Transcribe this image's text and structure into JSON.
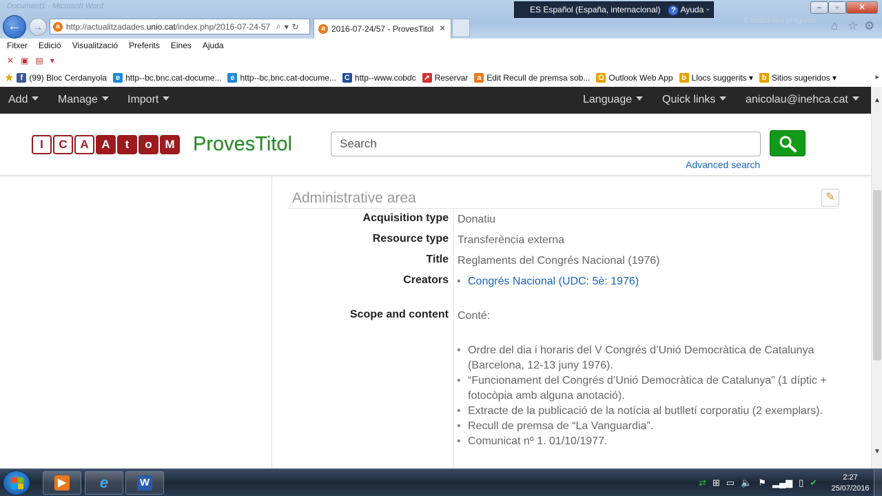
{
  "window": {
    "ghost_title": "Document1 - Microsoft Word",
    "language_bar": {
      "language": "ES Español (España, internacional)",
      "help": "Ayuda"
    },
    "search_ghost": "Escriba una pregunta"
  },
  "browser": {
    "url_prefix": "http://actualitzadades.",
    "url_host": "unio.cat",
    "url_path": "/index.php/2016-07-24-57",
    "tab_title": "2016-07-24/57 - ProvesTitol",
    "menu": [
      "Fitxer",
      "Edició",
      "Visualització",
      "Preferits",
      "Eines",
      "Ajuda"
    ],
    "favorites": [
      {
        "label": "(99) Bloc Cerdanyola",
        "icon": "facebook-icon",
        "color": "#3b5998",
        "glyph": "f"
      },
      {
        "label": "http--bc.bnc.cat-docume...",
        "icon": "ie-page-icon",
        "color": "#1e88d6",
        "glyph": "e"
      },
      {
        "label": "http--bc.bnc.cat-docume...",
        "icon": "ie-page-icon",
        "color": "#1e88d6",
        "glyph": "e"
      },
      {
        "label": "http--www.cobdc",
        "icon": "cobdc-icon",
        "color": "#1f4f9c",
        "glyph": "C"
      },
      {
        "label": "Reservar",
        "icon": "arrow-icon",
        "color": "#d32f2f",
        "glyph": "➚"
      },
      {
        "label": "Edit Recull de premsa sob...",
        "icon": "atom-site-icon",
        "color": "#e8791c",
        "glyph": "a"
      },
      {
        "label": "Outlook Web App",
        "icon": "outlook-icon",
        "color": "#e6a100",
        "glyph": "O"
      },
      {
        "label": "Llocs suggerits ▾",
        "icon": "bing-icon",
        "color": "#e6a100",
        "glyph": "b"
      },
      {
        "label": "Sitios sugeridos ▾",
        "icon": "bing-icon",
        "color": "#e6a100",
        "glyph": "b"
      }
    ]
  },
  "nav": {
    "add": "Add",
    "manage": "Manage",
    "import": "Import",
    "language": "Language",
    "quick_links": "Quick links",
    "user": "anicolau@inehca.cat"
  },
  "header": {
    "logo_letters": [
      "I",
      "C",
      "A",
      "A",
      "t",
      "o",
      "M"
    ],
    "site_name": "ProvesTitol",
    "search_placeholder": "Search",
    "advanced_search": "Advanced search"
  },
  "section": {
    "title": "Administrative area",
    "fields": {
      "acquisition_type": {
        "label": "Acquisition type",
        "value": "Donatiu"
      },
      "resource_type": {
        "label": "Resource type",
        "value": "Transferència externa"
      },
      "title": {
        "label": "Title",
        "value": "Reglaments del Congrés Nacional (1976)"
      },
      "creators": {
        "label": "Creators",
        "value": "Congrés Nacional (UDC: 5è: 1976)"
      },
      "scope": {
        "label": "Scope and content",
        "intro": "Conté:",
        "items": [
          "Ordre del dia i horaris del V Congrés d’Unió Democràtica de Catalunya (Barcelona, 12-13 juny 1976).",
          "“Funcionament del Congrés d’Unió Democràtica de Catalunya” (1 díptic + fotocòpia amb alguna anotació).",
          "Extracte de la publicació de la notícia al butlletí corporatiu (2 exemplars).",
          "Recull de premsa de “La Vanguardia”.",
          "Comunicat nº 1. 01/10/1977."
        ]
      }
    }
  },
  "taskbar": {
    "time": "2:27",
    "date": "25/07/2016"
  },
  "colors": {
    "brand_green": "#2e8a1d",
    "search_button": "#129b18",
    "logo_red": "#9b1b1f",
    "link_blue": "#1565c0",
    "nav_bg": "#272727"
  }
}
